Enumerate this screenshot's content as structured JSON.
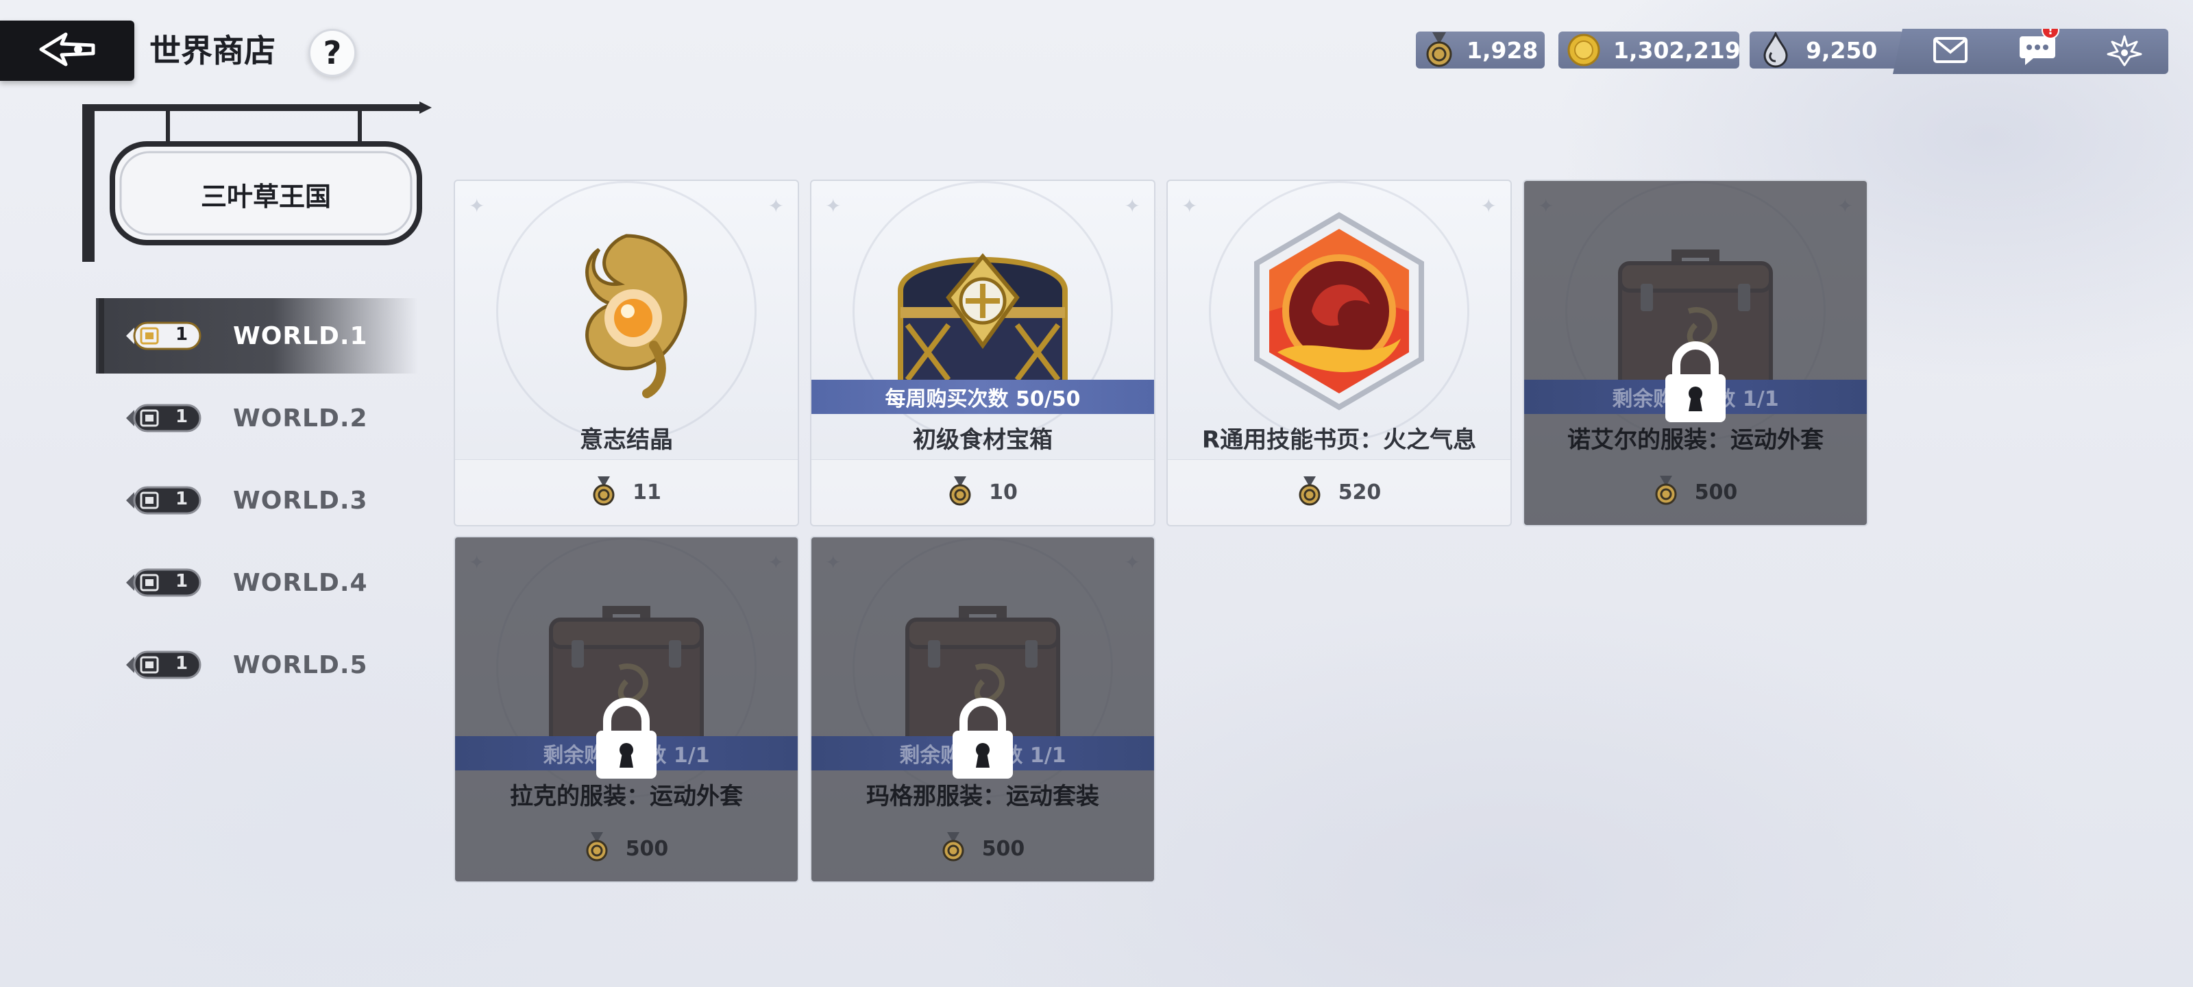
{
  "header": {
    "title": "世界商店",
    "help_label": "?"
  },
  "currencies": [
    {
      "icon": "medal-icon",
      "value": "1,928"
    },
    {
      "icon": "gold-coin-icon",
      "value": "1,302,219"
    },
    {
      "icon": "crystal-drop-icon",
      "value": "9,250"
    }
  ],
  "tray": {
    "notification_badge": "!",
    "icons": [
      "mail-icon",
      "chat-icon",
      "guild-emblem-icon"
    ]
  },
  "region": {
    "kingdom": "三叶草王国"
  },
  "worlds": [
    {
      "name": "WORLD.1",
      "badge": "1",
      "active": true
    },
    {
      "name": "WORLD.2",
      "badge": "1",
      "active": false
    },
    {
      "name": "WORLD.3",
      "badge": "1",
      "active": false
    },
    {
      "name": "WORLD.4",
      "badge": "1",
      "active": false
    },
    {
      "name": "WORLD.5",
      "badge": "1",
      "active": false
    }
  ],
  "items": [
    {
      "name": "意志结晶",
      "price": "11",
      "ribbon": "",
      "locked": false,
      "art": "will-crystal"
    },
    {
      "name": "初级食材宝箱",
      "price": "10",
      "ribbon": "每周购买次数 50/50",
      "locked": false,
      "art": "treasure-chest"
    },
    {
      "name": "R通用技能书页：火之气息",
      "price": "520",
      "ribbon": "",
      "locked": false,
      "art": "fire-skill-page"
    },
    {
      "name": "诺艾尔的服装：运动外套",
      "price": "500",
      "ribbon": "剩余购买次数 1/1",
      "locked": true,
      "art": "costume-case"
    },
    {
      "name": "拉克的服装：运动外套",
      "price": "500",
      "ribbon": "剩余购买次数 1/1",
      "locked": true,
      "art": "costume-case"
    },
    {
      "name": "玛格那服装：运动套装",
      "price": "500",
      "ribbon": "剩余购买次数 1/1",
      "locked": true,
      "art": "costume-case"
    }
  ]
}
